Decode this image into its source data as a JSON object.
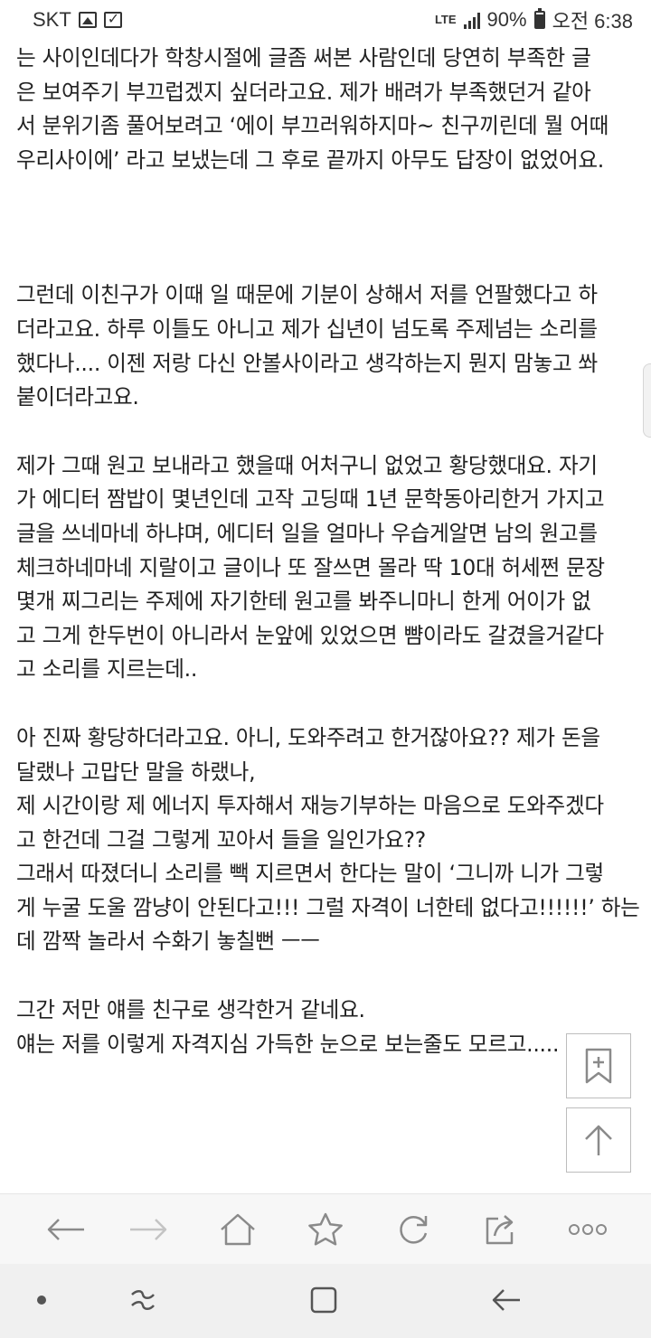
{
  "status_bar": {
    "carrier": "SKT",
    "network": "LTE",
    "battery": "90%",
    "battery_level": 0.9,
    "time": "오전 6:38"
  },
  "article": {
    "paragraphs": [
      [
        "는 사이인데다가 학창시절에 글좀 써본 사람인데 당연히 부족한 글",
        "은 보여주기 부끄럽겠지 싶더라고요. 제가 배려가 부족했던거 같아",
        "서 분위기좀 풀어보려고 ‘에이 부끄러워하지마~ 친구끼린데 뭘 어때",
        "우리사이에’ 라고 보냈는데 그 후로 끝까지 아무도 답장이 없었어요."
      ],
      [
        "그런데 이친구가 이때 일 때문에 기분이 상해서 저를 언팔했다고 하",
        "더라고요. 하루 이틀도 아니고 제가 십년이 넘도록 주제넘는 소리를",
        "했다나.... 이젠 저랑 다신 안볼사이라고 생각하는지 뭔지 맘놓고 쏴",
        "붙이더라고요."
      ],
      [
        "제가 그때 원고 보내라고 했을때 어처구니 없었고 황당했대요. 자기",
        "가 에디터 짬밥이 몇년인데 고작 고딩때 1년 문학동아리한거 가지고",
        "글을 쓰네마네 하냐며, 에디터 일을 얼마나 우습게알면 남의 원고를",
        "체크하네마네 지랄이고 글이나 또 잘쓰면 몰라 딱 10대 허세쩐 문장",
        "몇개 찌그리는 주제에 자기한테 원고를 봐주니마니 한게 어이가 없",
        "고 그게 한두번이 아니라서 눈앞에 있었으면 뺨이라도 갈겼을거같다",
        "고 소리를 지르는데.."
      ],
      [
        "아 진짜 황당하더라고요. 아니, 도와주려고 한거잖아요?? 제가 돈을",
        "달랬나 고맙단 말을 하랬나,",
        "제 시간이랑 제 에너지 투자해서 재능기부하는 마음으로 도와주겠다",
        "고 한건데 그걸 그렇게 꼬아서 들을 일인가요??",
        "그래서 따졌더니 소리를 빽 지르면서 한다는 말이 ‘그니까 니가 그렇",
        "게 누굴 도울 깜냥이 안된다고!!! 그럴 자격이 너한테 없다고!!!!!!’ 하는",
        "데 깜짝 놀라서 수화기 놓칠뻔 ㅡㅡ"
      ],
      [
        "그간 저만 얘를 친구로 생각한거 같네요.",
        "얘는 저를 이렇게 자격지심 가득한 눈으로 보는줄도 모르고....."
      ]
    ]
  },
  "icons": {
    "bookmark": "bookmark-add-icon",
    "scroll_top": "arrow-up-icon",
    "back": "arrow-left-icon",
    "forward": "arrow-right-icon",
    "home": "home-icon",
    "bookmarks": "star-icon",
    "refresh": "refresh-icon",
    "share": "share-icon",
    "more": "more-dots-icon",
    "recent_apps": "recent-apps-icon",
    "nav_home": "nav-home-icon",
    "nav_back": "nav-back-icon"
  },
  "colors": {
    "text": "#222222",
    "icon": "#8a8a8a",
    "icon_disabled": "#c4c4c4",
    "toolbar_bg": "#f7f7f7",
    "navbar_bg": "#f0f0f0"
  }
}
